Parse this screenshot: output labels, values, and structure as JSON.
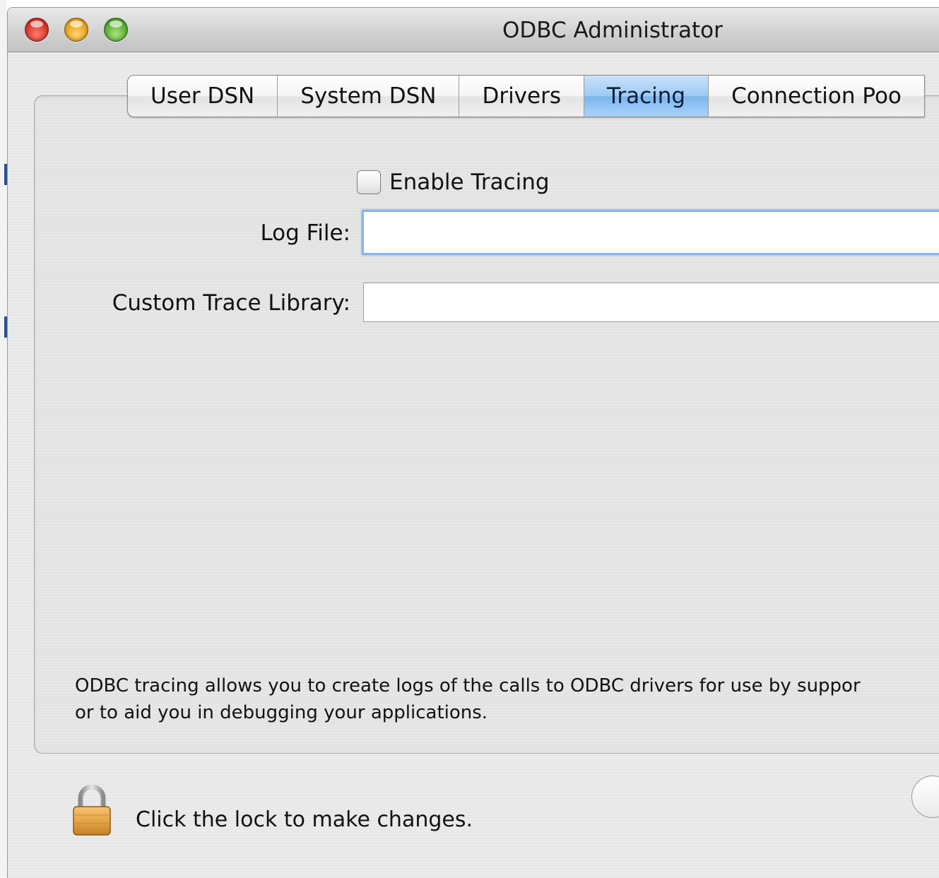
{
  "window": {
    "title": "ODBC Administrator"
  },
  "tabs": [
    {
      "label": "User DSN",
      "selected": false
    },
    {
      "label": "System DSN",
      "selected": false
    },
    {
      "label": "Drivers",
      "selected": false
    },
    {
      "label": "Tracing",
      "selected": true
    },
    {
      "label": "Connection Poo",
      "selected": false
    }
  ],
  "tracing": {
    "enable_label": "Enable Tracing",
    "enable_checked": false,
    "log_file_label": "Log File:",
    "log_file_value": "",
    "custom_trace_label": "Custom Trace Library:",
    "custom_trace_value": ""
  },
  "description": {
    "line1": "ODBC tracing allows you to create logs of the calls to ODBC drivers for use by suppor",
    "line2": "or to aid you in debugging your applications."
  },
  "footer": {
    "lock_text": "Click the lock to make changes."
  },
  "colors": {
    "selected_tab": "#9ecaf3",
    "focus_ring": "#86b4e8",
    "lock_body": "#e5a646"
  }
}
